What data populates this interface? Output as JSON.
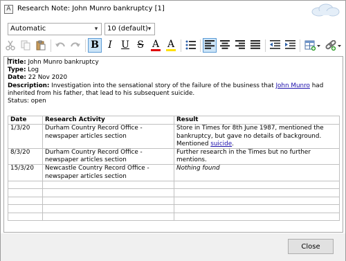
{
  "window": {
    "title": "Research Note: John Munro bankruptcy [1]",
    "app_icon_glyph": "A"
  },
  "format": {
    "style_value": "Automatic",
    "size_value": "10 (default)"
  },
  "toolbar": {
    "bold_glyph": "B",
    "italic_glyph": "I",
    "underline_glyph": "U",
    "strike_glyph": "S",
    "font_color_glyph": "A",
    "highlight_glyph": "A",
    "colors": {
      "font_color": "#e00000",
      "highlight": "#ffe100",
      "checked_bg": "#cce4f7"
    },
    "icons": [
      "cut-icon",
      "copy-icon",
      "paste-icon",
      "undo-icon",
      "redo-icon",
      "bold-icon",
      "italic-icon",
      "underline-icon",
      "strikethrough-icon",
      "font-color-icon",
      "highlight-color-icon",
      "bullet-list-icon",
      "align-left-icon",
      "align-center-icon",
      "align-right-icon",
      "justify-icon",
      "decrease-indent-icon",
      "increase-indent-icon",
      "insert-table-icon",
      "insert-link-icon"
    ]
  },
  "note": {
    "title_label": "Title:",
    "title_value": " John Munro bankruptcy",
    "type_label": "Type:",
    "type_value": " Log",
    "date_label": "Date:",
    "date_value": " 22 Nov 2020",
    "description_label": "Description:",
    "description_pre": " Investigation into the sensational story of the failure of the business that ",
    "description_link": "John Munro",
    "description_post": " had inherited from his father, that lead to his subsequent suicide.",
    "status_line": "Status: open"
  },
  "table": {
    "headers": [
      "Date",
      "Research Activity",
      "Result"
    ],
    "rows": [
      {
        "date": "1/3/20",
        "activity": "Durham Country Record Office - newspaper articles section",
        "result_pre": "Store in Times for 8th June 1987, mentioned the bankruptcy, but gave no details of background. Mentioned ",
        "result_link": "suicide",
        "result_post": "."
      },
      {
        "date": "8/3/20",
        "activity": "Durham Country Record Office - newspaper articles section",
        "result": "Further research in the Times but no further mentions."
      },
      {
        "date": "15/3/20",
        "activity": "Newcastle Country Record Office - newspaper articles section",
        "result_italic": "Nothing found"
      }
    ]
  },
  "footer": {
    "close_label": "Close"
  }
}
